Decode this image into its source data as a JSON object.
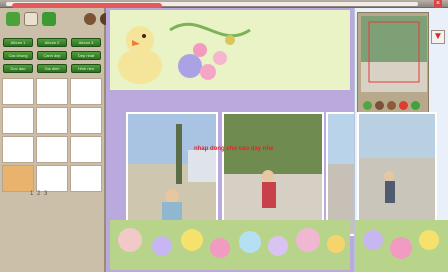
{
  "window": {
    "close_glyph": "×"
  },
  "toolbar": {
    "icons": [
      "open-folder-icon",
      "save-icon",
      "green-arrow-icon",
      "brown-circle-icon",
      "pot-icon",
      "flower-icon",
      "color-pencil-icon",
      "sun-icon",
      "leaf-icon",
      "help-icon",
      "exit-icon"
    ],
    "help_glyph": "?",
    "exit_glyph": "e"
  },
  "categories": [
    {
      "label": "Album 1"
    },
    {
      "label": "Album 2"
    },
    {
      "label": "Album 3"
    },
    {
      "label": "Cac khung"
    },
    {
      "label": "Canh dep"
    },
    {
      "label": "Dep nhat"
    },
    {
      "label": "Doc dao"
    },
    {
      "label": "Gia dinh"
    },
    {
      "label": "Hinh nen"
    }
  ],
  "thumbnails": [
    {
      "selected": false
    },
    {
      "selected": false
    },
    {
      "selected": false
    },
    {
      "selected": false
    },
    {
      "selected": false
    },
    {
      "selected": false
    },
    {
      "selected": false
    },
    {
      "selected": false
    },
    {
      "selected": false
    },
    {
      "selected": false
    },
    {
      "selected": false
    },
    {
      "selected": false
    },
    {
      "selected": true
    },
    {
      "selected": false
    },
    {
      "selected": false
    }
  ],
  "pager": {
    "text": "1 2 3"
  },
  "canvas": {
    "caption": "nhap dong chu vao day nhe",
    "caption_color": "#e4242b"
  },
  "preview": {
    "down_glyph": "▼"
  },
  "colors": {
    "left_panel": "#cbbfa9",
    "canvas_bg": "#b9a9dd",
    "accent_red": "#e45a5a",
    "button_green": "#3f8f30"
  }
}
